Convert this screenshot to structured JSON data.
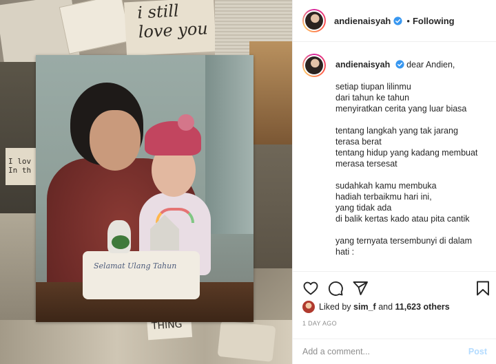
{
  "media": {
    "collage_text_still": "i still",
    "collage_text_loveyou": "love you",
    "collage_text_ilove": "I lov",
    "collage_text_inthe": "In th",
    "collage_text_thing": "THING",
    "cake_text": "Selamat Ulang Tahun"
  },
  "header": {
    "username": "andienaisyah",
    "separator": "•",
    "follow_status": "Following"
  },
  "caption": {
    "username": "andienaisyah",
    "opening": "dear Andien,",
    "lines": [
      "setiap tiupan lilinmu",
      "dari tahun ke tahun",
      "menyiratkan cerita yang luar biasa",
      "",
      "tentang langkah yang tak jarang",
      "terasa berat",
      "tentang hidup yang kadang membuat",
      "merasa tersesat",
      "",
      "sudahkah kamu membuka",
      "hadiah terbaikmu hari ini,",
      "yang tidak ada",
      "di balik kertas kado atau pita cantik",
      "",
      "yang ternyata tersembunyi di dalam",
      "hati :"
    ]
  },
  "actions": {
    "icons": [
      "heart-icon",
      "comment-icon",
      "share-icon",
      "bookmark-icon"
    ]
  },
  "likes": {
    "prefix": "Liked by",
    "user": "sim_f",
    "middle": "and",
    "others": "11,623 others"
  },
  "timestamp": "1 DAY AGO",
  "comment": {
    "placeholder": "Add a comment...",
    "post_label": "Post"
  },
  "colors": {
    "verified": "#3897f0",
    "post_disabled": "#b3dbff",
    "muted": "#8e8e8e"
  }
}
